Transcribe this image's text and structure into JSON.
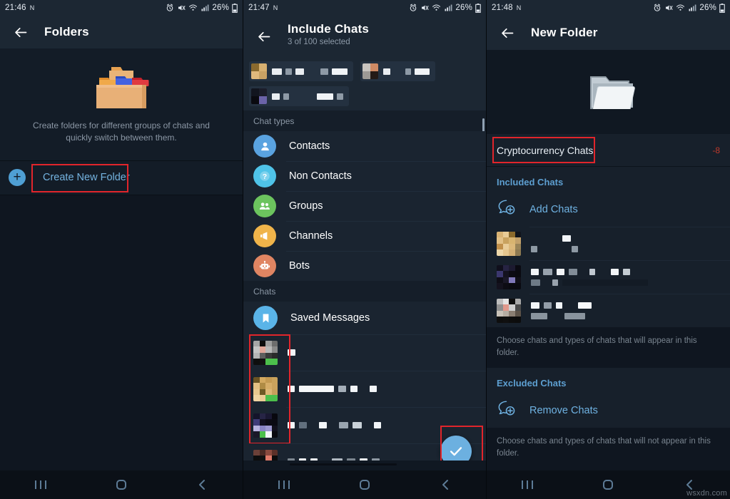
{
  "accent": {
    "blue": "#6cb0e0",
    "link_blue": "#74b3e0",
    "section_blue": "#5d9fd1",
    "highlight_red": "#e1252b",
    "counter_red": "#c0392b",
    "appbar_bg": "#1c2733",
    "panel_bg": "#0f1620",
    "list_bg": "#1a2430"
  },
  "panel1": {
    "status": {
      "time": "21:46",
      "nfc": "N",
      "battery_pct": "26%",
      "icons": [
        "alarm-icon",
        "mute-icon",
        "wifi-icon",
        "signal-icon",
        "battery-icon"
      ]
    },
    "appbar": {
      "back": "back-arrow-icon",
      "title": "Folders"
    },
    "hero": {
      "icon": "folders-stack-icon",
      "caption": "Create folders for different groups of chats and quickly switch between them."
    },
    "create_row": {
      "icon": "plus-circle-icon",
      "label": "Create New Folder",
      "highlighted": true
    },
    "nav": {
      "recents": "recents-icon",
      "home": "home-icon",
      "back": "back-icon"
    }
  },
  "panel2": {
    "status": {
      "time": "21:47",
      "nfc": "N",
      "battery_pct": "26%"
    },
    "appbar": {
      "back": "back-arrow-icon",
      "title": "Include Chats",
      "subtitle": "3 of 100 selected"
    },
    "selected_chips": [
      {
        "name": "redacted-chat-1"
      },
      {
        "name": "redacted-chat-2"
      },
      {
        "name": "redacted-chat-3"
      }
    ],
    "chat_types_header": "Chat types",
    "chat_types": [
      {
        "label": "Contacts",
        "icon": "person-icon",
        "color": "#5aa3e0"
      },
      {
        "label": "Non Contacts",
        "icon": "question-icon",
        "color": "#4fc3e8"
      },
      {
        "label": "Groups",
        "icon": "people-icon",
        "color": "#6cc45e"
      },
      {
        "label": "Channels",
        "icon": "megaphone-icon",
        "color": "#f0b44a"
      },
      {
        "label": "Bots",
        "icon": "robot-icon",
        "color": "#e08562"
      }
    ],
    "chats_header": "Chats",
    "saved_messages": {
      "label": "Saved Messages",
      "icon": "bookmark-icon",
      "color": "#5ab4e8"
    },
    "redacted_chats_count": 4,
    "selected_rows_highlighted": true,
    "fab": {
      "icon": "check-icon",
      "highlighted": true
    },
    "nav": {
      "recents": "recents-icon",
      "home": "home-icon",
      "back": "back-icon"
    }
  },
  "panel3": {
    "status": {
      "time": "21:48",
      "nfc": "N",
      "battery_pct": "26%"
    },
    "appbar": {
      "back": "back-arrow-icon",
      "title": "New Folder"
    },
    "hero": {
      "icon": "open-folder-icon"
    },
    "name_field": {
      "value": "Cryptocurrency Chats",
      "counter": "-8",
      "highlighted": true
    },
    "included": {
      "header": "Included Chats",
      "action": {
        "icon": "add-chat-icon",
        "label": "Add Chats"
      },
      "hint": "Choose chats and types of chats that will appear in this folder.",
      "rows": 3
    },
    "excluded": {
      "header": "Excluded Chats",
      "action": {
        "icon": "remove-chat-icon",
        "label": "Remove Chats"
      },
      "hint": "Choose chats and types of chats that will not appear in this folder."
    },
    "watermark": "wsxdn.com",
    "nav": {
      "recents": "recents-icon",
      "home": "home-icon",
      "back": "back-icon"
    }
  }
}
